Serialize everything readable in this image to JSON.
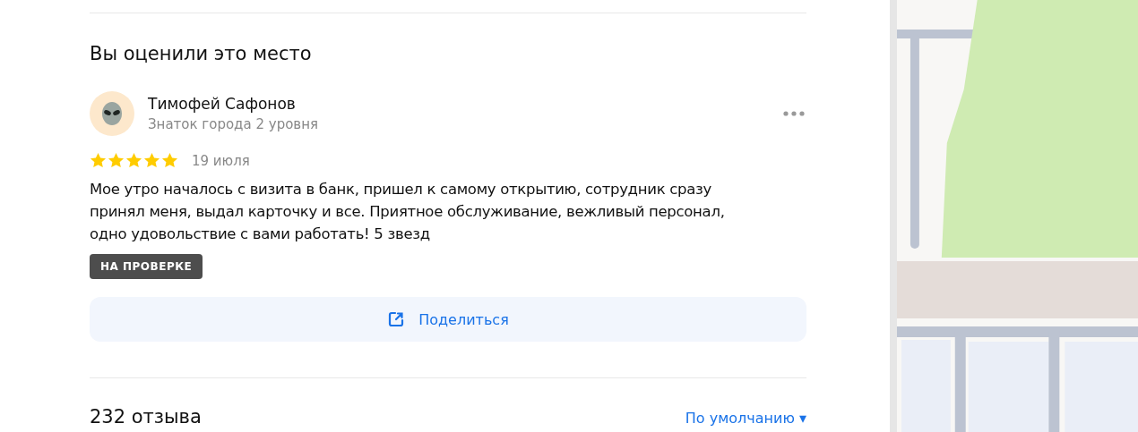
{
  "section_title": "Вы оценили это место",
  "review": {
    "author": "Тимофей Сафонов",
    "author_level": "Знаток города 2 уровня",
    "stars": 5,
    "date": "19 июля",
    "text": "Мое утро началось с визита в банк, пришел к самому открытию, сотрудник сразу принял меня, выдал карточку и все. Приятное обслуживание, вежливый персонал, одно удовольствие с вами работать! 5 звезд",
    "status_badge": "НА ПРОВЕРКЕ",
    "share_button": "Поделиться"
  },
  "reviews_header": {
    "count": "232 отзыва",
    "sort": "По умолчанию",
    "sort_caret": "▾"
  }
}
